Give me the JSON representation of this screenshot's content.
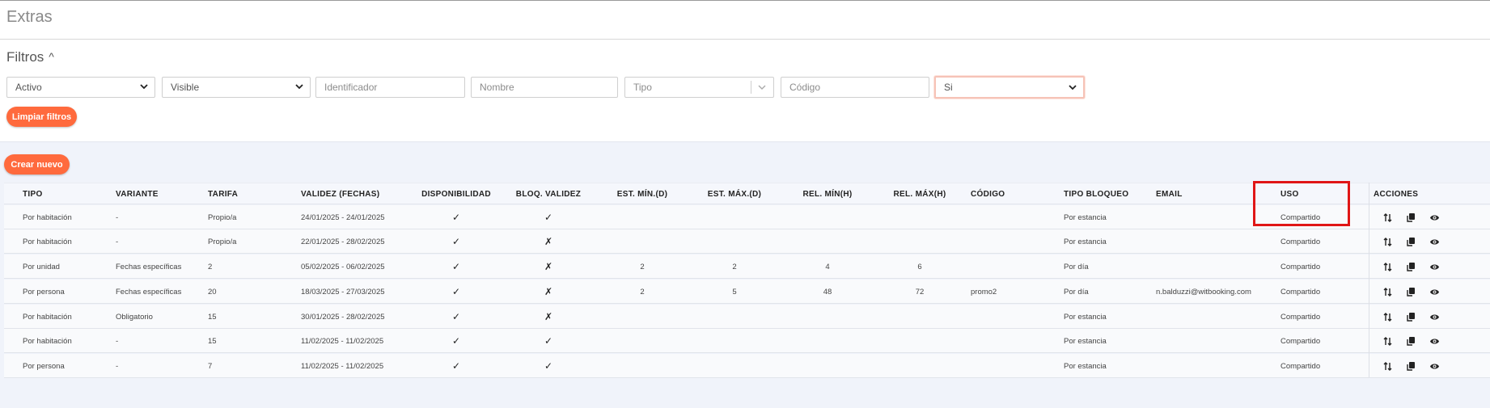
{
  "page": {
    "title": "Extras"
  },
  "filters": {
    "title": "Filtros",
    "activo": "Activo",
    "visible": "Visible",
    "identificador_placeholder": "Identificador",
    "nombre_placeholder": "Nombre",
    "tipo_placeholder": "Tipo",
    "codigo_placeholder": "Código",
    "last_select": "Si",
    "clear_label": "Limpiar filtros"
  },
  "create_label": "Crear nuevo",
  "table": {
    "headers": {
      "tipo": "TIPO",
      "variante": "VARIANTE",
      "tarifa": "TARIFA",
      "validez": "VALIDEZ (FECHAS)",
      "disponibilidad": "DISPONIBILIDAD",
      "bloq": "BLOQ. VALIDEZ",
      "estmin": "EST. MÍN.(D)",
      "estmax": "EST. MÁX.(D)",
      "relmin": "REL. MÍN(H)",
      "relmax": "REL. MÁX(H)",
      "codigo": "CÓDIGO",
      "tipobloqueo": "TIPO BLOQUEO",
      "email": "EMAIL",
      "uso": "USO",
      "acciones": "ACCIONES"
    },
    "rows": [
      {
        "tipo": "Por habitación",
        "variante": "-",
        "tarifa": "Propio/a",
        "validez": "24/01/2025 - 24/01/2025",
        "disponibilidad": "✓",
        "bloq": "✓",
        "estmin": "",
        "estmax": "",
        "relmin": "",
        "relmax": "",
        "codigo": "",
        "tipobloqueo": "Por estancia",
        "email": "",
        "uso": "Compartido"
      },
      {
        "tipo": "Por habitación",
        "variante": "-",
        "tarifa": "Propio/a",
        "validez": "22/01/2025 - 28/02/2025",
        "disponibilidad": "✓",
        "bloq": "✗",
        "estmin": "",
        "estmax": "",
        "relmin": "",
        "relmax": "",
        "codigo": "",
        "tipobloqueo": "Por estancia",
        "email": "",
        "uso": "Compartido"
      },
      {
        "tipo": "Por unidad",
        "variante": "Fechas específicas",
        "tarifa": "2",
        "validez": "05/02/2025 - 06/02/2025",
        "disponibilidad": "✓",
        "bloq": "✗",
        "estmin": "2",
        "estmax": "2",
        "relmin": "4",
        "relmax": "6",
        "codigo": "",
        "tipobloqueo": "Por día",
        "email": "",
        "uso": "Compartido"
      },
      {
        "tipo": "Por persona",
        "variante": "Fechas específicas",
        "tarifa": "20",
        "validez": "18/03/2025 - 27/03/2025",
        "disponibilidad": "✓",
        "bloq": "✗",
        "estmin": "2",
        "estmax": "5",
        "relmin": "48",
        "relmax": "72",
        "codigo": "promo2",
        "tipobloqueo": "Por día",
        "email": "n.balduzzi@witbooking.com",
        "uso": "Compartido"
      },
      {
        "tipo": "Por habitación",
        "variante": "Obligatorio",
        "tarifa": "15",
        "validez": "30/01/2025 - 28/02/2025",
        "disponibilidad": "✓",
        "bloq": "✗",
        "estmin": "",
        "estmax": "",
        "relmin": "",
        "relmax": "",
        "codigo": "",
        "tipobloqueo": "Por estancia",
        "email": "",
        "uso": "Compartido"
      },
      {
        "tipo": "Por habitación",
        "variante": "-",
        "tarifa": "15",
        "validez": "11/02/2025 - 11/02/2025",
        "disponibilidad": "✓",
        "bloq": "✓",
        "estmin": "",
        "estmax": "",
        "relmin": "",
        "relmax": "",
        "codigo": "",
        "tipobloqueo": "Por estancia",
        "email": "",
        "uso": "Compartido"
      },
      {
        "tipo": "Por persona",
        "variante": "-",
        "tarifa": "7",
        "validez": "11/02/2025 - 11/02/2025",
        "disponibilidad": "✓",
        "bloq": "✓",
        "estmin": "",
        "estmax": "",
        "relmin": "",
        "relmax": "",
        "codigo": "",
        "tipobloqueo": "Por estancia",
        "email": "",
        "uso": "Compartido"
      }
    ]
  },
  "colors": {
    "accent": "#ff6a3d",
    "highlight_box": "#e01616"
  },
  "icons": {
    "sort": "sort-arrows-icon",
    "duplicate": "copy-icon",
    "view": "eye-icon"
  }
}
